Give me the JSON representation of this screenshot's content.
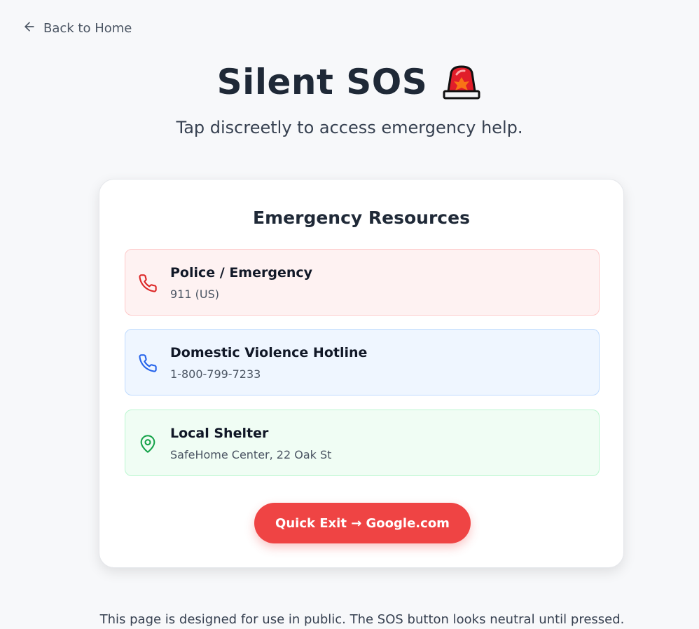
{
  "nav": {
    "back_label": "Back to Home"
  },
  "header": {
    "title": "Silent SOS",
    "icon": "siren-icon",
    "subtitle": "Tap discreetly to access emergency help."
  },
  "card": {
    "heading": "Emergency Resources",
    "resources": [
      {
        "title": "Police / Emergency",
        "detail": "911 (US)",
        "icon": "phone-icon",
        "color": "#dc2626"
      },
      {
        "title": "Domestic Violence Hotline",
        "detail": "1-800-799-7233",
        "icon": "phone-icon",
        "color": "#2563eb"
      },
      {
        "title": "Local Shelter",
        "detail": "SafeHome Center, 22 Oak St",
        "icon": "map-pin-icon",
        "color": "#16a34a"
      }
    ],
    "quick_exit_label": "Quick Exit → Google.com"
  },
  "footer": {
    "note": "This page is designed for use in public. The SOS button looks neutral until pressed."
  },
  "colors": {
    "accent_red": "#ef4444",
    "background": "#f7f8fa"
  }
}
